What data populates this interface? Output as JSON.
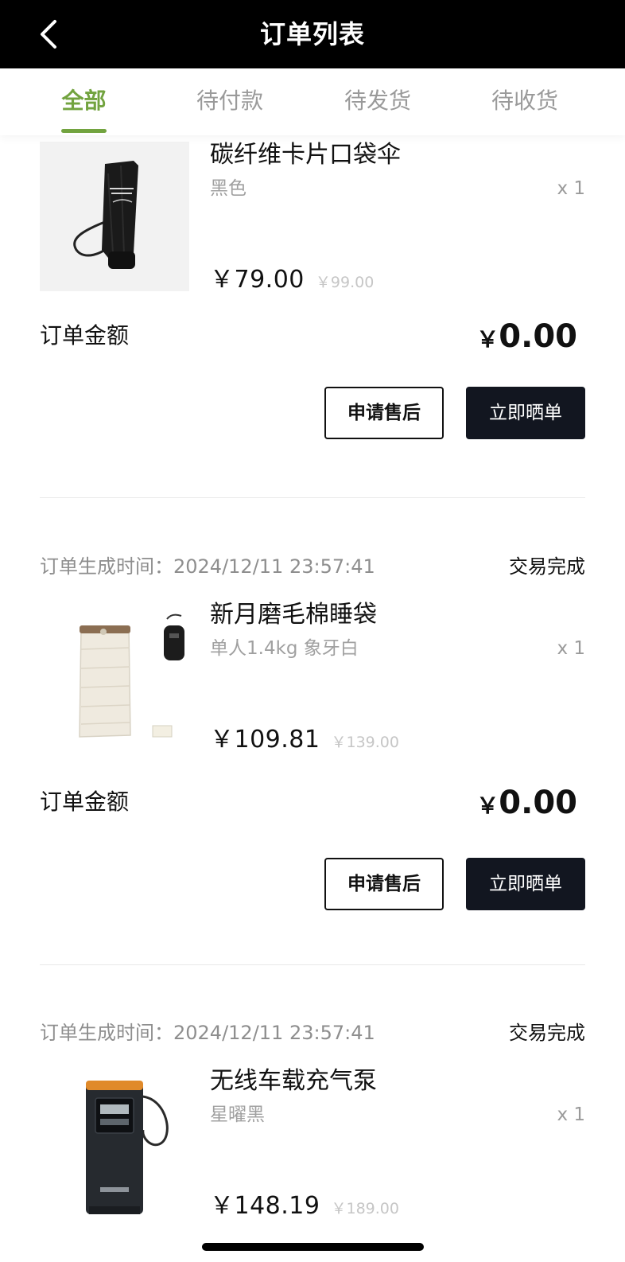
{
  "header": {
    "title": "订单列表",
    "back_icon": "chevron-left-icon"
  },
  "tabs": [
    {
      "label": "全部",
      "active": true
    },
    {
      "label": "待付款",
      "active": false
    },
    {
      "label": "待发货",
      "active": false
    },
    {
      "label": "待收货",
      "active": false
    }
  ],
  "accent_color": "#72a33f",
  "orders": [
    {
      "product": {
        "name": "碳纤维卡片口袋伞",
        "spec": "黑色",
        "qty": "x 1",
        "price_currency": "￥",
        "price": "79.00",
        "original_price": "￥99.00",
        "thumb_icon": "umbrella-image"
      },
      "amount_label": "订单金额",
      "amount_currency": "￥",
      "amount_value": "0.00",
      "actions": {
        "after_sale": "申请售后",
        "review": "立即晒单"
      }
    },
    {
      "time_label": "订单生成时间：2024/12/11 23:57:41",
      "status": "交易完成",
      "product": {
        "name": "新月磨毛棉睡袋",
        "spec": "单人1.4kg 象牙白",
        "qty": "x 1",
        "price_currency": "￥",
        "price": "109.81",
        "original_price": "￥139.00",
        "thumb_icon": "sleeping-bag-image"
      },
      "amount_label": "订单金额",
      "amount_currency": "￥",
      "amount_value": "0.00",
      "actions": {
        "after_sale": "申请售后",
        "review": "立即晒单"
      }
    },
    {
      "time_label": "订单生成时间：2024/12/11 23:57:41",
      "status": "交易完成",
      "product": {
        "name": "无线车载充气泵",
        "spec": "星曜黑",
        "qty": "x 1",
        "price_currency": "￥",
        "price": "148.19",
        "original_price": "￥189.00",
        "thumb_icon": "air-pump-image"
      }
    }
  ]
}
